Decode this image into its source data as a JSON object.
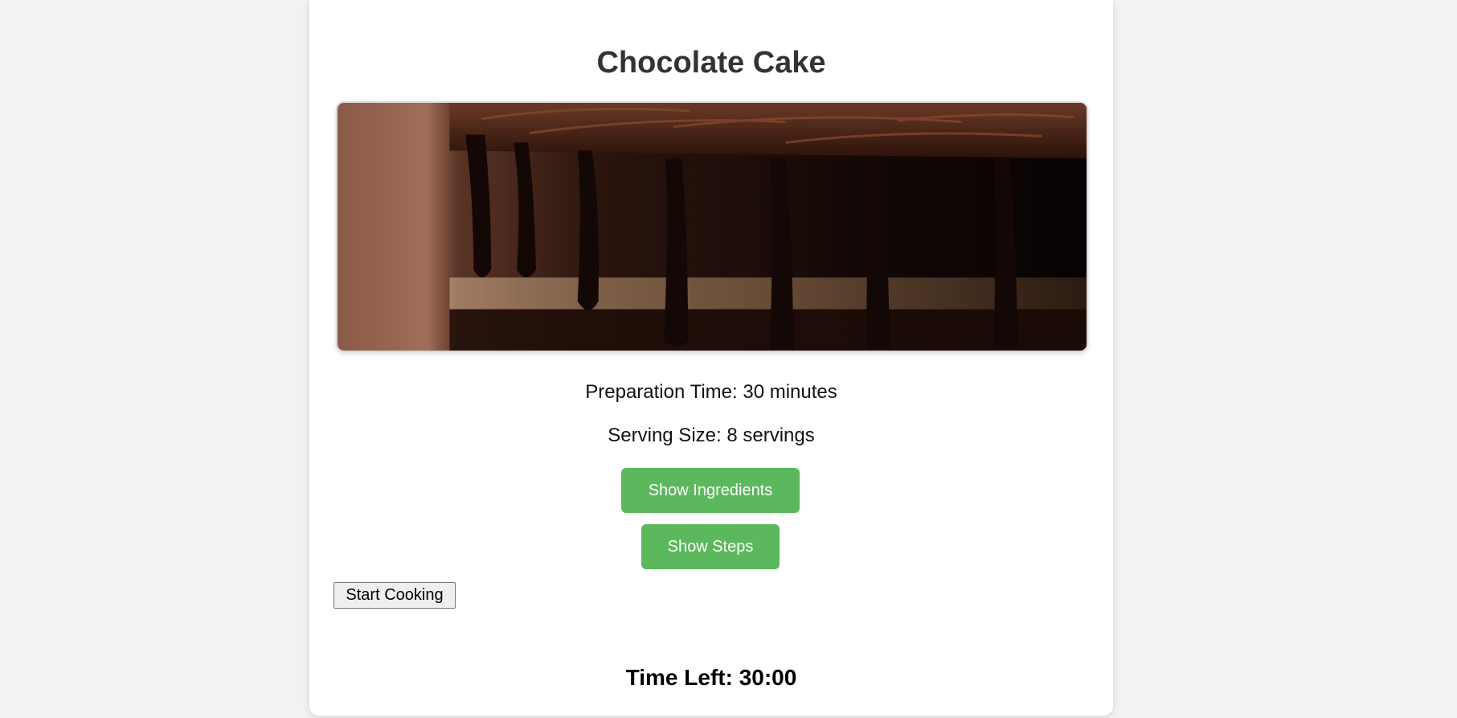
{
  "recipe": {
    "title": "Chocolate Cake",
    "preparation": "Preparation Time: 30 minutes",
    "serving": "Serving Size: 8 servings"
  },
  "buttons": {
    "show_ingredients": "Show Ingredients",
    "show_steps": "Show Steps",
    "start_cooking": "Start Cooking"
  },
  "timer": {
    "label": "Time Left: 30:00"
  },
  "colors": {
    "page_background": "#f2f2f2",
    "card_background": "#ffffff",
    "button_green": "#5cb85c",
    "title_text": "#333333"
  }
}
